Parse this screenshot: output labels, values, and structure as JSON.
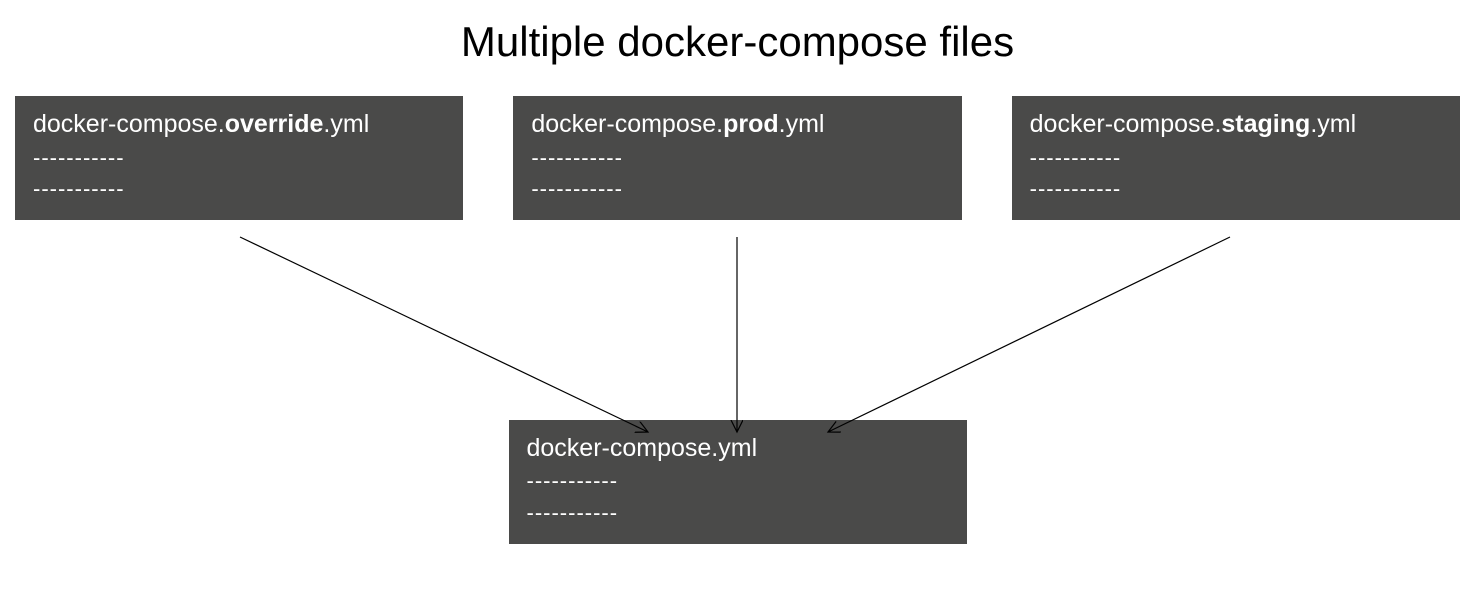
{
  "title": "Multiple docker-compose files",
  "boxes": {
    "override": {
      "prefix": "docker-compose.",
      "bold": "override",
      "suffix": ".yml",
      "dashes1": "-----------",
      "dashes2": "-----------"
    },
    "prod": {
      "prefix": "docker-compose.",
      "bold": "prod",
      "suffix": ".yml",
      "dashes1": "-----------",
      "dashes2": "-----------"
    },
    "staging": {
      "prefix": "docker-compose.",
      "bold": "staging",
      "suffix": ".yml",
      "dashes1": "-----------",
      "dashes2": "-----------"
    },
    "base": {
      "label": "docker-compose.yml",
      "dashes1": "-----------",
      "dashes2": "-----------"
    }
  }
}
